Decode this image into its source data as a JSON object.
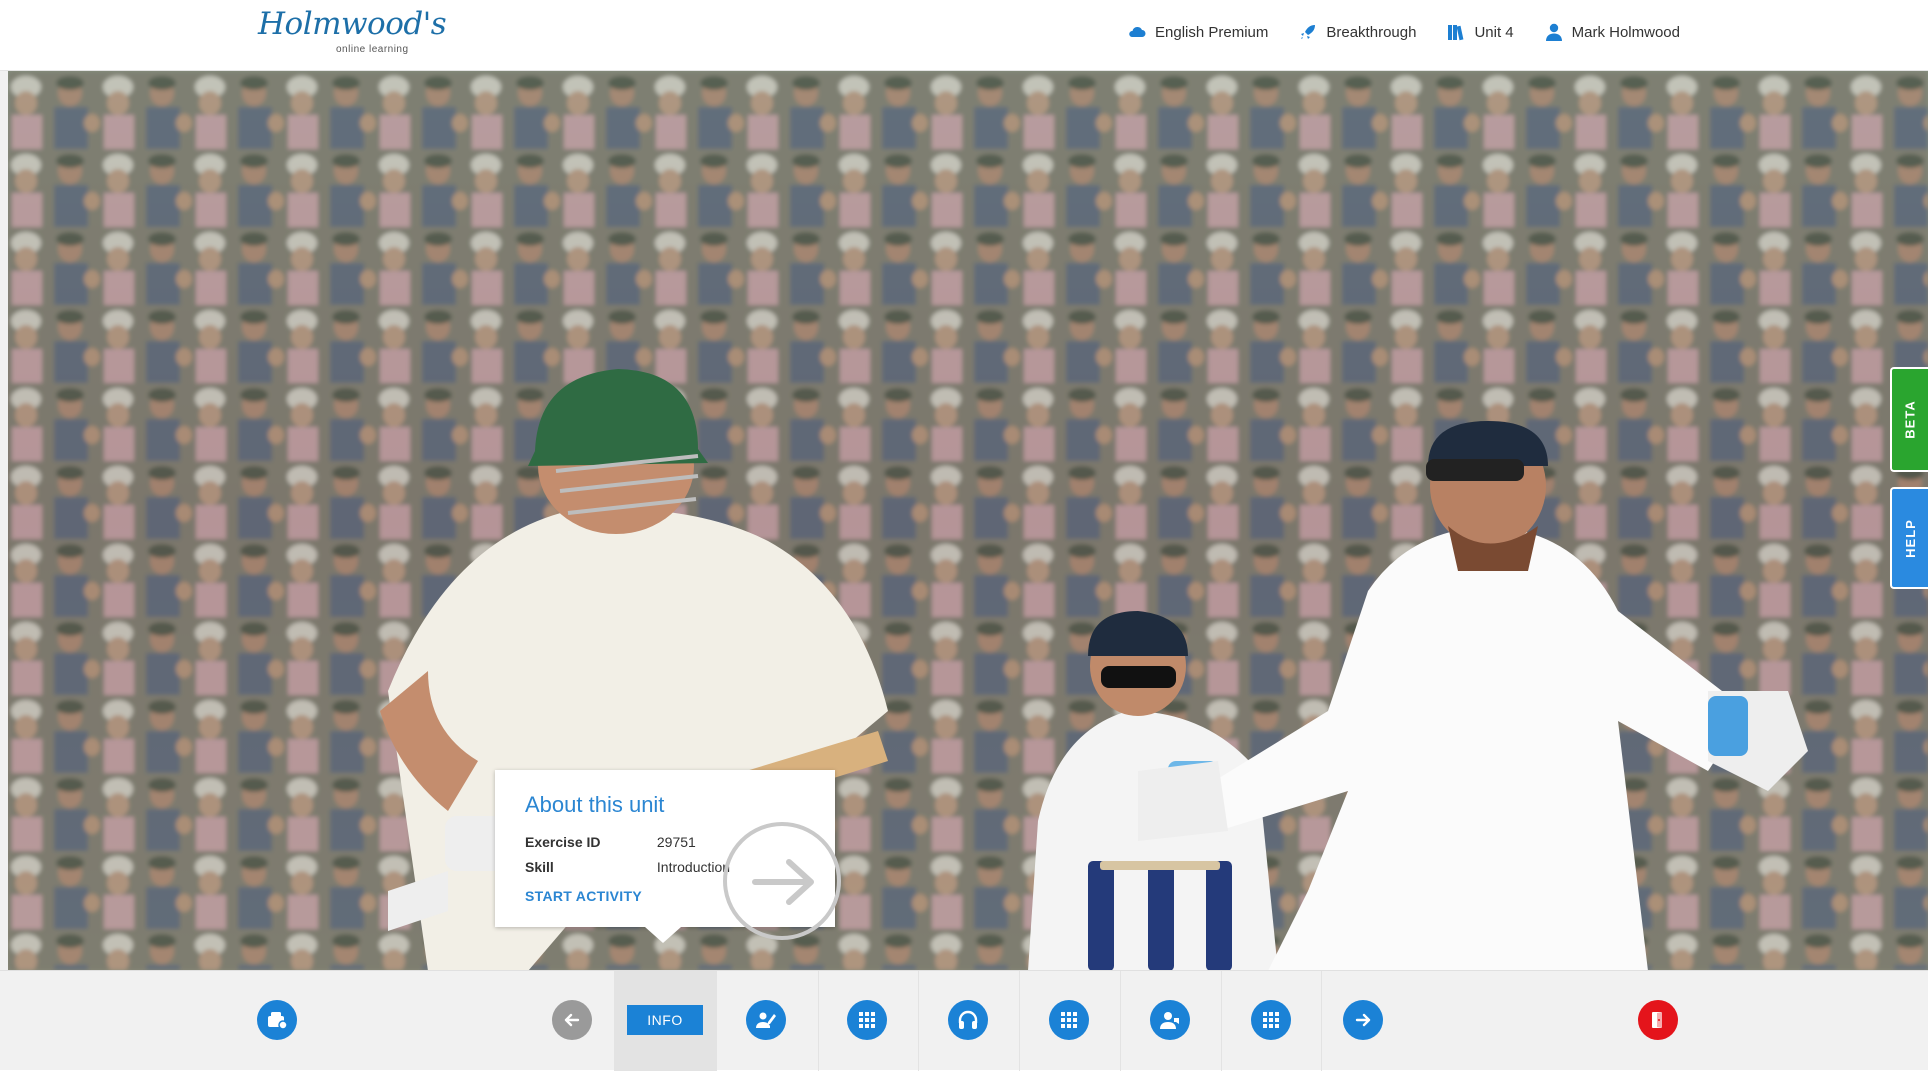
{
  "header": {
    "logo_text": "Holmwood's",
    "logo_subtitle": "online learning",
    "nav": [
      {
        "label": "English Premium",
        "icon": "cloud-icon"
      },
      {
        "label": "Breakthrough",
        "icon": "rocket-icon"
      },
      {
        "label": "Unit 4",
        "icon": "books-icon"
      },
      {
        "label": "Mark Holmwood",
        "icon": "user-icon"
      }
    ]
  },
  "side_tabs": {
    "beta": "BETA",
    "help": "HELP"
  },
  "card": {
    "title": "About this unit",
    "exercise_id_label": "Exercise ID",
    "exercise_id_value": "29751",
    "skill_label": "Skill",
    "skill_value": "Introduction",
    "start_link": "START ACTIVITY"
  },
  "toolbar": {
    "info_label": "INFO",
    "buttons": [
      "box-icon",
      "arrow-left-icon",
      "info-tab",
      "writing-icon",
      "grid-icon",
      "headphones-icon",
      "grid-icon",
      "speaking-icon",
      "grid-icon",
      "arrow-right-icon",
      "exit-icon"
    ]
  },
  "colors": {
    "accent": "#1b82d6",
    "beta": "#2aa52f",
    "help": "#2a8ae0",
    "exit": "#e4141b"
  }
}
